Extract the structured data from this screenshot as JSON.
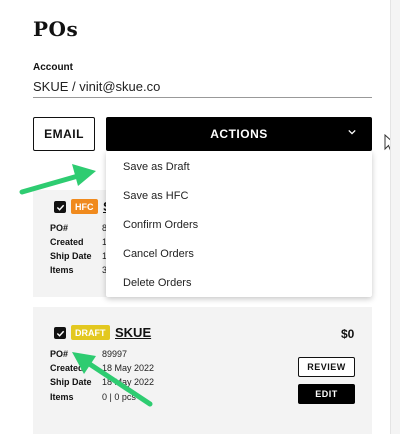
{
  "page": {
    "title": "POs"
  },
  "account": {
    "label": "Account",
    "value": "SKUE / vinit@skue.co"
  },
  "toolbar": {
    "email_label": "EMAIL",
    "actions_label": "ACTIONS"
  },
  "actions_menu": {
    "items": [
      "Save as Draft",
      "Save as HFC",
      "Confirm Orders",
      "Cancel Orders",
      "Delete Orders"
    ]
  },
  "orders": [
    {
      "badge": "HFC",
      "vendor": "S",
      "fields": [
        {
          "key": "PO#",
          "value": "8"
        },
        {
          "key": "Created",
          "value": "1"
        },
        {
          "key": "Ship Date",
          "value": "1"
        },
        {
          "key": "Items",
          "value": "3"
        }
      ]
    },
    {
      "badge": "DRAFT",
      "vendor": "SKUE",
      "amount": "$0",
      "fields": [
        {
          "key": "PO#",
          "value": "89997"
        },
        {
          "key": "Created",
          "value": "18 May 2022"
        },
        {
          "key": "Ship Date",
          "value": "18 May 2022"
        },
        {
          "key": "Items",
          "value": "0 | 0 pcs"
        }
      ],
      "review_label": "REVIEW",
      "edit_label": "EDIT"
    }
  ],
  "colors": {
    "hfc_badge": "#f08a1d",
    "draft_badge": "#e3c81f",
    "annotation_arrow": "#2ecc71"
  }
}
